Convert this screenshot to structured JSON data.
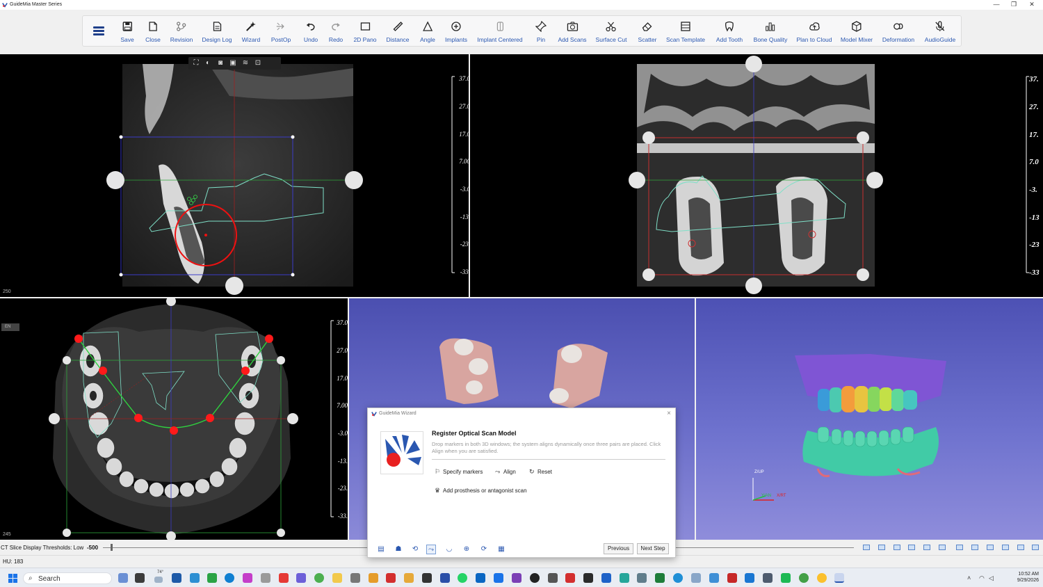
{
  "window": {
    "title": "GuideMia Master Series",
    "controls": [
      "—",
      "❐",
      "✕"
    ]
  },
  "toolbar": {
    "items": [
      {
        "id": "save",
        "label": "Save",
        "icon": "save-icon"
      },
      {
        "id": "close",
        "label": "Close",
        "icon": "close-file-icon"
      },
      {
        "id": "revision",
        "label": "Revision",
        "icon": "revision-icon"
      },
      {
        "id": "design-log",
        "label": "Design Log",
        "icon": "design-log-icon"
      },
      {
        "id": "wizard",
        "label": "Wizard",
        "icon": "wizard-wand-icon"
      },
      {
        "id": "postop",
        "label": "PostOp",
        "icon": "postop-icon"
      },
      {
        "id": "undo",
        "label": "Undo",
        "icon": "undo-icon"
      },
      {
        "id": "redo",
        "label": "Redo",
        "icon": "redo-icon"
      },
      {
        "id": "pano",
        "label": "2D Pano",
        "icon": "pano-icon"
      },
      {
        "id": "distance",
        "label": "Distance",
        "icon": "ruler-icon"
      },
      {
        "id": "angle",
        "label": "Angle",
        "icon": "angle-icon"
      },
      {
        "id": "implants",
        "label": "Implants",
        "icon": "implant-plus-icon"
      },
      {
        "id": "implant-centered",
        "label": "Implant Centered",
        "icon": "implant-centered-icon"
      },
      {
        "id": "pin",
        "label": "Pin",
        "icon": "pin-icon"
      },
      {
        "id": "add-scans",
        "label": "Add Scans",
        "icon": "add-scan-camera-icon"
      },
      {
        "id": "surface-cut",
        "label": "Surface Cut",
        "icon": "scissors-icon"
      },
      {
        "id": "scatter",
        "label": "Scatter",
        "icon": "eraser-icon"
      },
      {
        "id": "scan-template",
        "label": "Scan Template",
        "icon": "scan-template-icon"
      },
      {
        "id": "add-tooth",
        "label": "Add Tooth",
        "icon": "tooth-icon"
      },
      {
        "id": "bone-quality",
        "label": "Bone Quality",
        "icon": "bar-chart-icon"
      },
      {
        "id": "plan-to-cloud",
        "label": "Plan to Cloud",
        "icon": "cloud-upload-icon"
      },
      {
        "id": "model-mixer",
        "label": "Model Mixer",
        "icon": "cube-icon"
      },
      {
        "id": "deformation",
        "label": "Deformation",
        "icon": "deformation-icon"
      },
      {
        "id": "audio-guide",
        "label": "AudioGuide",
        "icon": "mic-off-icon"
      }
    ]
  },
  "viewports": {
    "sagittal": {
      "slice_number": "250",
      "ruler": [
        "37.0",
        "27.0",
        "17.0",
        "7.00",
        "-3.0",
        "-13.",
        "-23.",
        "-33."
      ]
    },
    "coronal": {
      "ruler": [
        "37.",
        "27.",
        "17.",
        "7.0",
        "-3.",
        "-13",
        "-23",
        "-33"
      ]
    },
    "axial": {
      "slice_number": "245",
      "orientation_tag": "EN",
      "ruler": [
        "37.0",
        "27.0",
        "17.0",
        "7.00",
        "-3.0",
        "-13.",
        "-23.",
        "-33."
      ]
    },
    "scan3d": {
      "axis_up": "Z/UP",
      "axis_y": "Y/AN",
      "axis_x": "X/RT"
    }
  },
  "wizard": {
    "title": "GuideMia Wizard",
    "heading": "Register Optical Scan Model",
    "description": "Drop markers in both 3D windows; the system aligns dynamically once three pairs are placed. Click Align when you are satisfied.",
    "actions": {
      "specify": "Specify markers",
      "align": "Align",
      "reset": "Reset",
      "add_prosthesis": "Add prosthesis or antagonist scan"
    },
    "footer": {
      "previous": "Previous",
      "next": "Next Step"
    }
  },
  "threshold": {
    "label": "CT Slice Display Thresholds: Low",
    "value": "-500"
  },
  "status": {
    "hu": "HU: 183"
  },
  "taskbar": {
    "search_placeholder": "Search",
    "weather": "74°",
    "time": "10:52 AM",
    "date": "9/29/2026"
  },
  "colors": {
    "accent_blue": "#2a57b0",
    "marker_red": "#ff1a1a",
    "outline_green": "#32d34a",
    "scan_outline": "#7fe0c8",
    "viewport_bg": "#000000",
    "scene_blue": "#5b5fc0"
  }
}
